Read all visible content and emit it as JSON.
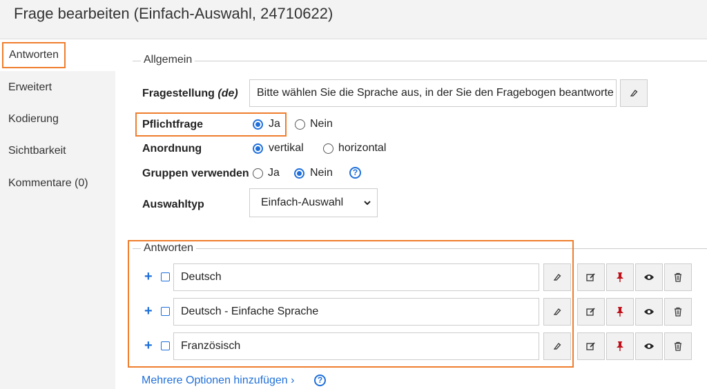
{
  "header": {
    "title": "Frage bearbeiten (Einfach-Auswahl, 24710622)"
  },
  "sidebar": {
    "items": [
      {
        "label": "Antworten"
      },
      {
        "label": "Erweitert"
      },
      {
        "label": "Kodierung"
      },
      {
        "label": "Sichtbarkeit"
      },
      {
        "label": "Kommentare (0)"
      }
    ]
  },
  "general": {
    "legend": "Allgemein",
    "question_label": "Fragestellung",
    "question_lang": "(de)",
    "question_value": "Bitte wählen Sie die Sprache aus, in der Sie den Fragebogen beantworte",
    "mandatory_label": "Pflichtfrage",
    "mandatory_yes": "Ja",
    "mandatory_no": "Nein",
    "arrangement_label": "Anordnung",
    "arrangement_vertical": "vertikal",
    "arrangement_horizontal": "horizontal",
    "groups_label": "Gruppen verwenden",
    "groups_yes": "Ja",
    "groups_no": "Nein",
    "selection_type_label": "Auswahltyp",
    "selection_type_value": "Einfach-Auswahl"
  },
  "answers": {
    "legend": "Antworten",
    "items": [
      {
        "value": "Deutsch"
      },
      {
        "value": "Deutsch - Einfache Sprache"
      },
      {
        "value": "Französisch"
      }
    ],
    "add_more_label": "Mehrere Optionen hinzufügen ›"
  },
  "colors": {
    "accent": "#1e6fd9",
    "highlight": "#ef7d2c",
    "pin": "#c0101a"
  }
}
